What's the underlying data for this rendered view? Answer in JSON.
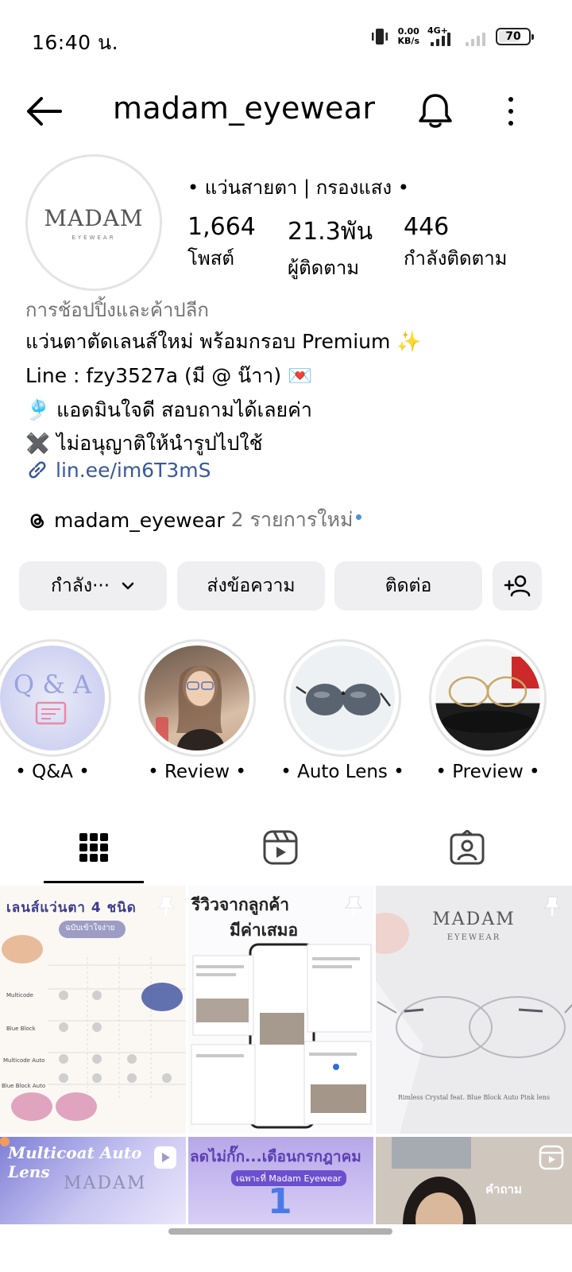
{
  "status_bar": {
    "time": "16:40 น.",
    "net_speed_value": "0.00",
    "net_speed_unit": "KB/s",
    "network": "4G+",
    "battery": "70"
  },
  "header": {
    "username": "madam_eyewear",
    "icons": [
      "arrow-left-icon",
      "bell-icon",
      "more-vertical-icon"
    ]
  },
  "profile": {
    "avatar_text": "MADAM",
    "avatar_subtext": "EYEWEAR",
    "tagline": "• แว่นสายตา | กรองแสง •",
    "stats": [
      {
        "value": "1,664",
        "label": "โพสต์"
      },
      {
        "value": "21.3พัน",
        "label": "ผู้ติดตาม"
      },
      {
        "value": "446",
        "label": "กำลังติดตาม"
      }
    ],
    "category": "การช้อปปิ้งและค้าปลีก",
    "bio_lines": [
      "แว่นตาตัดเลนส์ใหม่ พร้อมกรอบ Premium ✨",
      "Line : fzy3527a (มี @ น๊าา) 💌",
      "🎐 แอดมินใจดี สอบถามได้เลยค่า",
      "✖️ ไม่อนุญาติให้นำรูปไปใช้"
    ],
    "link": "lin.ee/im6T3mS",
    "threads": {
      "name": "madam_eyewear",
      "new_items": "2 รายการใหม่"
    }
  },
  "actions": {
    "following": "กำลัง···",
    "message": "ส่งข้อความ",
    "contact": "ติดต่อ"
  },
  "highlights": [
    {
      "label": "• Q&A •"
    },
    {
      "label": "• Review •"
    },
    {
      "label": "• Auto Lens •"
    },
    {
      "label": "• Preview •"
    }
  ],
  "tabs": [
    "grid-icon",
    "reels-icon",
    "tagged-icon"
  ],
  "posts": [
    {
      "caption": "เลนส์แว่นตา 4 ชนิด",
      "sub": "ฉบับเข้าใจง่าย"
    },
    {
      "caption": "รีวิวจากลูกค้า",
      "caption2": "มีค่าเสมอ"
    },
    {
      "caption": "MADAM",
      "sub": "EYEWEAR",
      "footer": "Rimless Crystal feat. Blue Block Auto Pink lens"
    },
    {
      "caption": "Multicoat Auto Lens"
    },
    {
      "caption": "ลดไม่กั๊ก...เดือนกรกฎาคม",
      "sub": "เฉพาะที่ Madam Eyewear"
    },
    {
      "caption": "คำถาม"
    }
  ],
  "colors": {
    "accent_link": "#385898",
    "button_bg": "#efeff1",
    "muted": "#737373"
  }
}
